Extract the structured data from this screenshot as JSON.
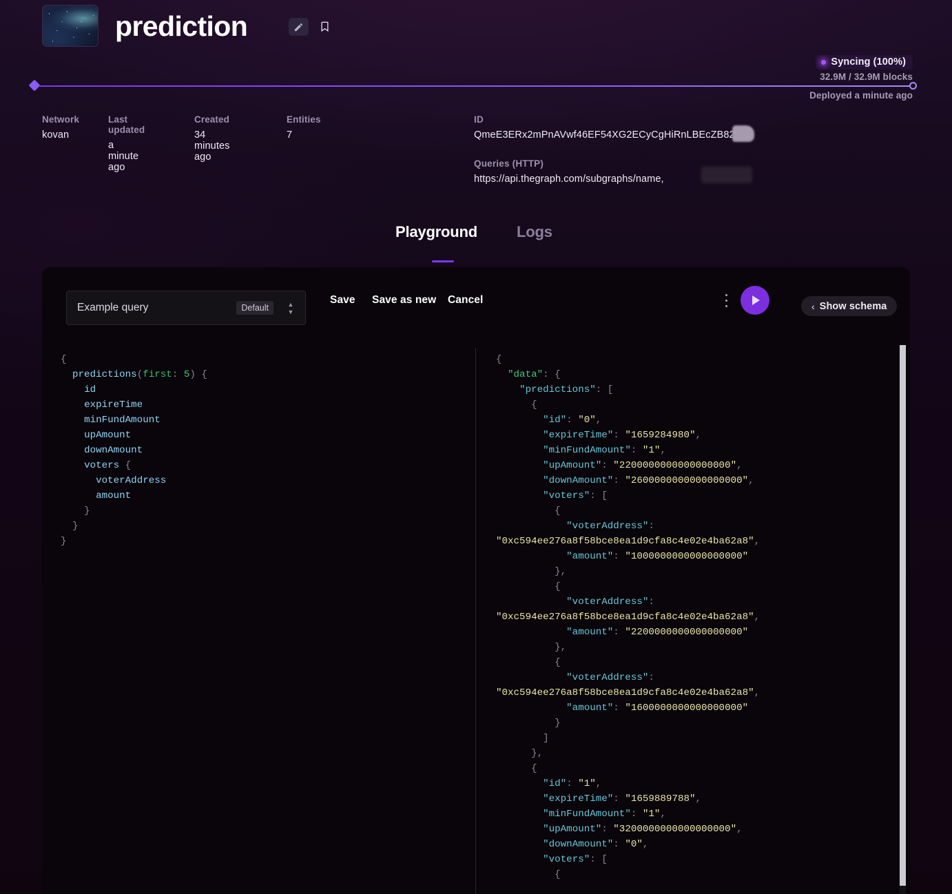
{
  "header": {
    "title": "prediction",
    "thumbnail_alt": "galaxy-thumbnail",
    "edit_icon": "pencil-icon",
    "bookmark_icon": "bookmark-icon"
  },
  "sync": {
    "status_label": "Syncing (100%)",
    "blocks": "32.9M / 32.9M blocks",
    "deployed": "Deployed a minute ago",
    "progress_percent": 100,
    "accent_color": "#8b5cf6"
  },
  "meta": [
    {
      "label": "Network",
      "value": "kovan"
    },
    {
      "label": "Last updated",
      "value": "a minute ago"
    },
    {
      "label": "Created",
      "value": "34 minutes ago"
    },
    {
      "label": "Entities",
      "value": "7"
    }
  ],
  "ids": {
    "id_label": "ID",
    "id_value": "QmeE3ERx2mPnAVwf46EF54XG2ECyCgHiRnLBEcZB824g",
    "queries_label": "Queries (HTTP)",
    "queries_value": "https://api.thegraph.com/subgraphs/name,"
  },
  "tabs": [
    {
      "label": "Playground",
      "active": true
    },
    {
      "label": "Logs",
      "active": false
    }
  ],
  "toolbar": {
    "query_name": "Example query",
    "query_badge": "Default",
    "save_label": "Save",
    "save_as_new_label": "Save as new",
    "cancel_label": "Cancel",
    "kebab_icon": "more-vertical-icon",
    "run_icon": "play-icon",
    "schema_label": "Show schema",
    "schema_chevron": "chevron-left-icon"
  },
  "editor": {
    "query": "{\n  predictions(first: 5) {\n    id\n    expireTime\n    minFundAmount\n    upAmount\n    downAmount\n    voters {\n      voterAddress\n      amount\n    }\n  }\n}"
  },
  "result": {
    "data": {
      "predictions": [
        {
          "id": "0",
          "expireTime": "1659284980",
          "minFundAmount": "1",
          "upAmount": "2200000000000000000",
          "downAmount": "2600000000000000000",
          "voters": [
            {
              "voterAddress": "0xc594ee276a8f58bce8ea1d9cfa8c4e02e4ba62a8",
              "amount": "1000000000000000000"
            },
            {
              "voterAddress": "0xc594ee276a8f58bce8ea1d9cfa8c4e02e4ba62a8",
              "amount": "2200000000000000000"
            },
            {
              "voterAddress": "0xc594ee276a8f58bce8ea1d9cfa8c4e02e4ba62a8",
              "amount": "1600000000000000000"
            }
          ]
        },
        {
          "id": "1",
          "expireTime": "1659889788",
          "minFundAmount": "1",
          "upAmount": "3200000000000000000",
          "downAmount": "0",
          "voters": []
        }
      ]
    }
  }
}
